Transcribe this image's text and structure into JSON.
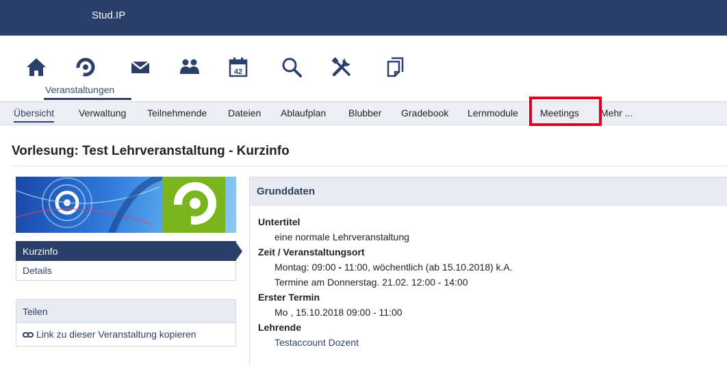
{
  "app": {
    "brand": "Stud.IP"
  },
  "iconnav": {
    "items": [
      {
        "name": "home-icon"
      },
      {
        "name": "courses-icon"
      },
      {
        "name": "messages-icon"
      },
      {
        "name": "community-icon"
      },
      {
        "name": "calendar-icon",
        "glyph": "42"
      },
      {
        "name": "search-icon"
      },
      {
        "name": "tools-icon"
      },
      {
        "name": "files-icon"
      }
    ],
    "active_label": "Veranstaltungen"
  },
  "subnav": {
    "tabs": [
      {
        "label": "Übersicht",
        "active": true
      },
      {
        "label": "Verwaltung"
      },
      {
        "label": "Teilnehmende"
      },
      {
        "label": "Dateien"
      },
      {
        "label": "Ablaufplan"
      },
      {
        "label": "Blubber"
      },
      {
        "label": "Gradebook"
      },
      {
        "label": "Lernmodule"
      },
      {
        "label": "Meetings",
        "highlighted": true
      },
      {
        "label": "Mehr ..."
      }
    ]
  },
  "page": {
    "title": "Vorlesung: Test Lehrveranstaltung - Kurzinfo"
  },
  "sidebar": {
    "items": [
      {
        "label": "Kurzinfo",
        "active": true
      },
      {
        "label": "Details"
      }
    ],
    "share": {
      "heading": "Teilen",
      "link": "Link zu dieser Veranstaltung kopieren"
    }
  },
  "content": {
    "heading": "Grunddaten",
    "untertitel_label": "Untertitel",
    "untertitel_value": "eine normale Lehrveranstaltung",
    "zeit_label": "Zeit / Veranstaltungsort",
    "zeit_line1_a": "Montag: 09:00 ",
    "zeit_line1_dash": "-",
    "zeit_line1_b": " 11:00, wöchentlich (ab 15.10.2018) k.A.",
    "zeit_line2": "Termine am Donnerstag. 21.02. 12:00 - 14:00",
    "erster_label": "Erster Termin",
    "erster_value": "Mo , 15.10.2018 09:00 - 11:00",
    "lehrende_label": "Lehrende",
    "lehrende_value": "Testaccount Dozent"
  },
  "colors": {
    "brand_blue": "#2b3f6b",
    "highlight_red": "#e0001b",
    "logo_green": "#7ab51d"
  }
}
